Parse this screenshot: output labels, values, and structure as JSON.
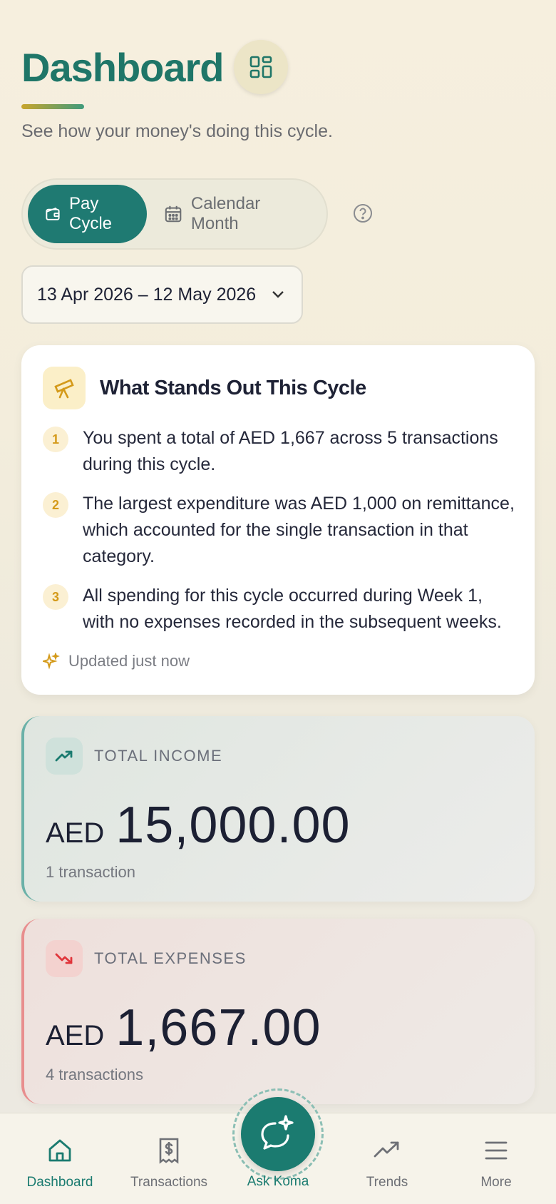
{
  "header": {
    "title": "Dashboard",
    "subtitle": "See how your money's doing this cycle."
  },
  "toggle": {
    "options": [
      {
        "label": "Pay Cycle",
        "icon": "wallet-icon",
        "selected": true
      },
      {
        "label": "Calendar Month",
        "icon": "calendar-icon",
        "selected": false
      }
    ]
  },
  "date_range": {
    "value": "13 Apr 2026 – 12 May 2026"
  },
  "insights": {
    "title": "What Stands Out This Cycle",
    "items": [
      {
        "num": "1",
        "text": "You spent a total of AED 1,667 across 5 transactions during this cycle."
      },
      {
        "num": "2",
        "text": "The largest expenditure was AED 1,000 on remittance, which accounted for the single transaction in that category."
      },
      {
        "num": "3",
        "text": "All spending for this cycle occurred during Week 1, with no expenses recorded in the subsequent weeks."
      }
    ],
    "updated": "Updated just now"
  },
  "income": {
    "label": "TOTAL INCOME",
    "currency": "AED",
    "amount": "15,000.00",
    "sub": "1 transaction",
    "color": "#1b7b70"
  },
  "expenses": {
    "label": "TOTAL EXPENSES",
    "currency": "AED",
    "amount": "1,667.00",
    "sub": "4 transactions",
    "color": "#e0353b"
  },
  "nav": {
    "items": [
      {
        "label": "Dashboard",
        "icon": "home-icon",
        "active": true
      },
      {
        "label": "Transactions",
        "icon": "receipt-icon",
        "active": false
      },
      {
        "label": "Ask Koma",
        "icon": "chat-sparkle-icon",
        "active": false
      },
      {
        "label": "Trends",
        "icon": "trend-icon",
        "active": false
      },
      {
        "label": "More",
        "icon": "menu-icon",
        "active": false
      }
    ]
  },
  "colors": {
    "accent": "#1f7a72",
    "title": "#1f7668",
    "highlight": "#d49a1a"
  }
}
